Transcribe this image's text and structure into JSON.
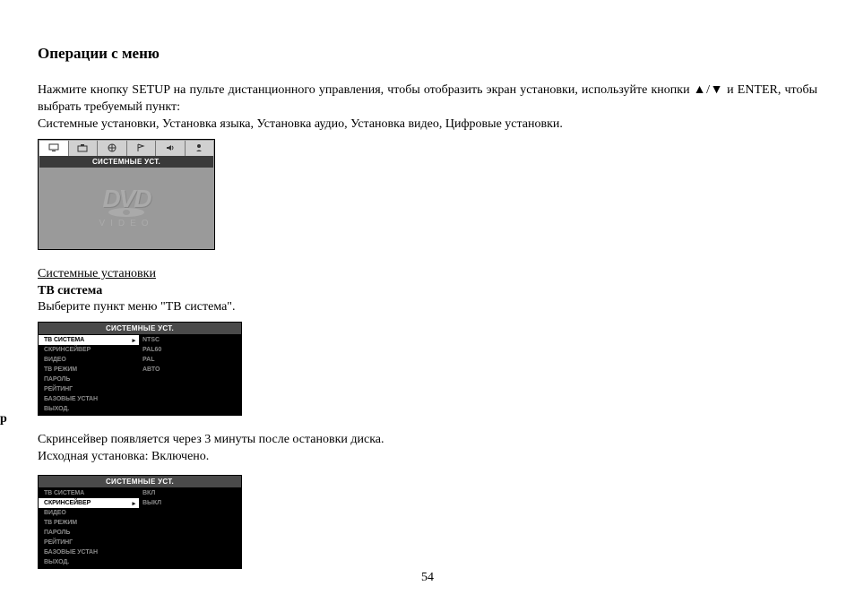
{
  "fragment_left": "р",
  "heading": "Операции с меню",
  "para1": "Нажмите кнопку SETUP на пульте дистанционного управления, чтобы отобразить экран установки, используйте кнопки ▲/▼ и ENTER, чтобы выбрать требуемый пункт:",
  "para2": "Системные установки, Установка языка, Установка аудио, Установка видео, Цифровые установки.",
  "osd1": {
    "title": "СИСТЕМНЫЕ УСТ.",
    "dvd": "DVD",
    "video": "VIDEO"
  },
  "section1": {
    "head": "Системные установки",
    "sub": "ТВ система",
    "desc": "Выберите пункт меню \"ТВ система\"."
  },
  "osd2": {
    "title": "СИСТЕМНЫЕ УСТ.",
    "left": [
      "ТВ СИСТЕМА",
      "СКРИНСЕЙВЕР",
      "ВИДЕО",
      "ТВ РЕЖИМ",
      "ПАРОЛЬ",
      "РЕЙТИНГ",
      "БАЗОВЫЕ УСТАН",
      "ВЫХОД."
    ],
    "right": [
      "NTSC",
      "PAL60",
      "PAL",
      "АВТО"
    ],
    "hl_left_index": 0
  },
  "section2": {
    "line1": "Скринсейвер появляется через 3 минуты после остановки диска.",
    "line2": "Исходная установка: Включено."
  },
  "osd3": {
    "title": "СИСТЕМНЫЕ УСТ.",
    "left": [
      "ТВ СИСТЕМА",
      "СКРИНСЕЙВЕР",
      "ВИДЕО",
      "ТВ РЕЖИМ",
      "ПАРОЛЬ",
      "РЕЙТИНГ",
      "БАЗОВЫЕ УСТАН",
      "ВЫХОД."
    ],
    "right": [
      "ВКЛ",
      "ВЫКЛ"
    ],
    "hl_left_index": 1
  },
  "page": "54"
}
